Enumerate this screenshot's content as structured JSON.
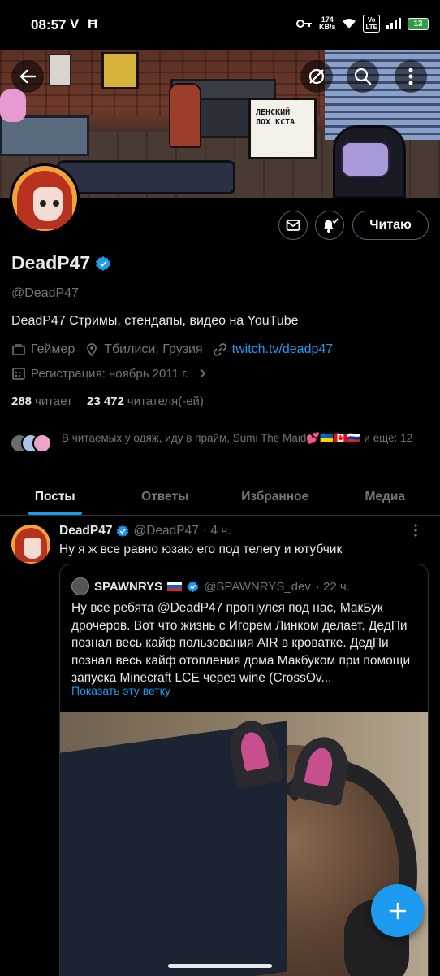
{
  "status_bar": {
    "time": "08:57",
    "net_speed_top": "174",
    "net_speed_bottom": "KB/s",
    "lte_label_top": "Vo",
    "lte_label_bottom": "LTE",
    "battery": "13"
  },
  "profile": {
    "display_name": "DeadP47",
    "handle": "@DeadP47",
    "bio": "DeadP47 Стримы, стендапы, видео на YouTube",
    "category": "Геймер",
    "location": "Тбилиси, Грузия",
    "website": "twitch.tv/deadp47_",
    "joined": "Регистрация: ноябрь 2011 г.",
    "following_count": "288",
    "following_label": "читает",
    "followers_count": "23 472",
    "followers_label": "читателя(-ей)",
    "followed_by": "В читаемых у одяж, иду в прайм, Sumi The Maid💕🇺🇦🇨🇦🇷🇺 и еще: 12",
    "follow_button": "Читаю",
    "banner_speech": "ЛЕНСКИЙ ЛОХ КСТА"
  },
  "tabs": [
    {
      "label": "Посты",
      "active": true
    },
    {
      "label": "Ответы",
      "active": false
    },
    {
      "label": "Избранное",
      "active": false
    },
    {
      "label": "Медиа",
      "active": false
    }
  ],
  "post": {
    "author": "DeadP47",
    "handle": "@DeadP47",
    "time": "· 4 ч.",
    "text": "Ну я ж все равно юзаю его под телегу и ютубчик",
    "quote": {
      "author": "SPAWNRYS",
      "handle": "@SPAWNRYS_dev",
      "time": "· 22 ч.",
      "text": "Ну все ребята @DeadP47 прогнулся под нас, МакБук дрочеров. Вот что жизнь с Игорем Линком делает. ДедПи познал весь кайф пользования AIR в кроватке. ДедПи познал весь кайф отопления дома Макбуком при помощи запуска Minecraft LCE через wine (CrossOv...",
      "show_thread": "Показать эту ветку"
    }
  },
  "colors": {
    "accent": "#1d9bf0",
    "background": "#000000",
    "text": "#e7e9ea",
    "muted": "#71767b"
  }
}
